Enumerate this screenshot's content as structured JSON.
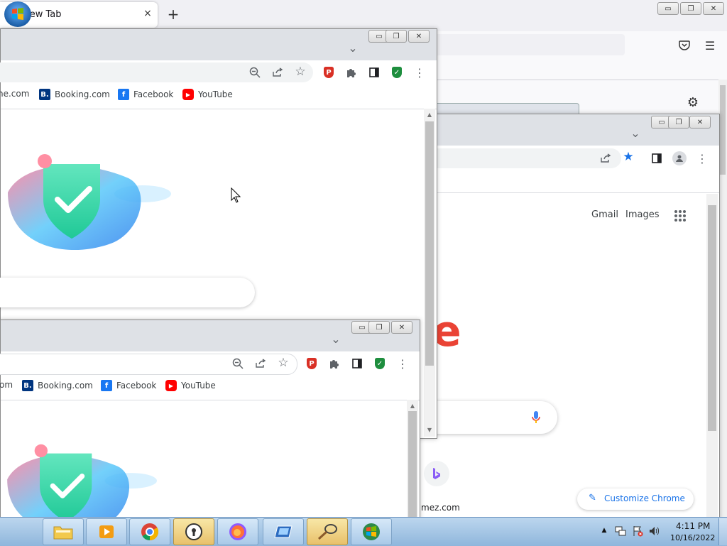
{
  "firefox": {
    "tab_title": "New Tab",
    "icons": {
      "favicon": "firefox-icon",
      "close": "×",
      "newtab": "+",
      "minimize": "▭",
      "restore": "❐",
      "close_win": "✕",
      "pocket": "pocket-icon",
      "menu": "☰",
      "gear": "⚙"
    }
  },
  "chrome_right": {
    "chevron": "⌄",
    "header_links": {
      "gmail": "Gmail",
      "images": "Images"
    },
    "partial_logo_letter": "e",
    "shortcut_label": "mez.com",
    "customize_label": "Customize Chrome"
  },
  "chrome_top": {
    "bookmarks": [
      {
        "label": "ne.com",
        "icon": ""
      },
      {
        "label": "Booking.com",
        "icon": "B."
      },
      {
        "label": "Facebook",
        "icon": "f"
      },
      {
        "label": "YouTube",
        "icon": "▶"
      }
    ],
    "chevron": "⌄"
  },
  "chrome_bottom": {
    "bookmarks": [
      {
        "label": "om",
        "icon": ""
      },
      {
        "label": "Booking.com",
        "icon": "B."
      },
      {
        "label": "Facebook",
        "icon": "f"
      },
      {
        "label": "YouTube",
        "icon": "▶"
      }
    ],
    "chevron": "⌄"
  },
  "taskbar": {
    "time": "4:11 PM",
    "date": "10/16/2022",
    "apps": [
      "file-explorer",
      "media-player",
      "chrome",
      "app-lock",
      "firefox",
      "remote-desktop",
      "net-tool",
      "windows-icon"
    ]
  },
  "colors": {
    "accent_blue": "#1a73e8",
    "google_red": "#ea4335",
    "booking_blue": "#003580",
    "facebook_blue": "#1877f2",
    "youtube_red": "#ff0000"
  }
}
